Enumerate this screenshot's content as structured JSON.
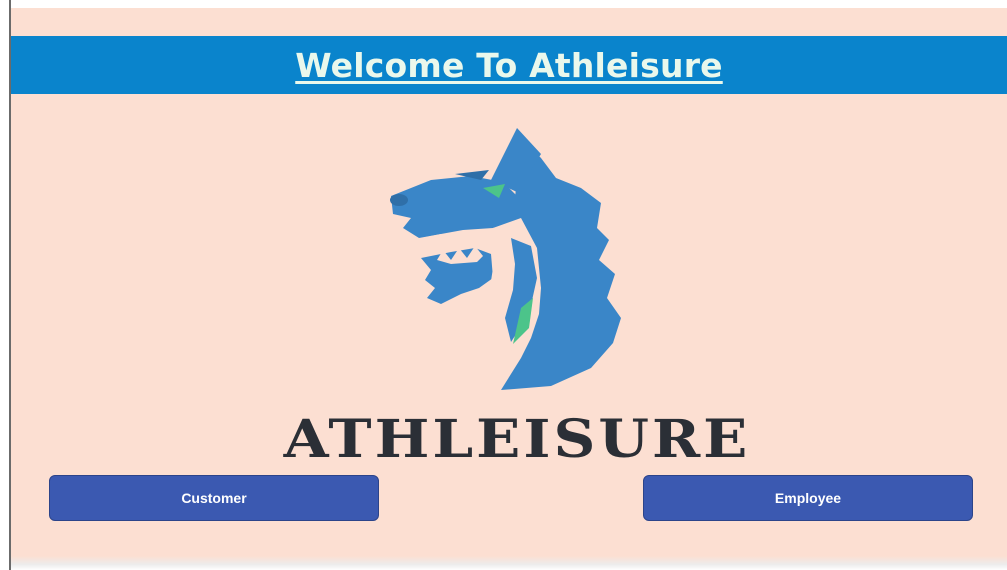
{
  "header": {
    "title": "Welcome To Athleisure"
  },
  "logo": {
    "icon": "wolf-head-icon",
    "wordmark": "ATHLEISURE"
  },
  "buttons": {
    "customer_label": "Customer",
    "employee_label": "Employee"
  },
  "colors": {
    "background": "#fcdfd2",
    "header": "#0a84cc",
    "header_text": "#eaf8ec",
    "button": "#3b59b1",
    "logo_blue": "#3a86c8",
    "logo_green": "#4cc48a",
    "wordmark": "#2b2f36"
  }
}
